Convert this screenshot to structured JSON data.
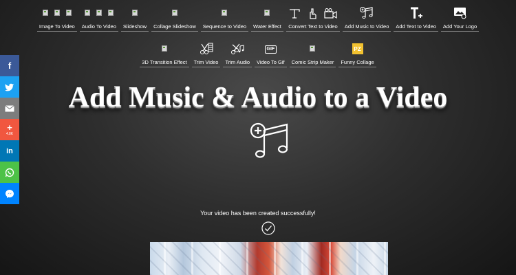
{
  "nav": {
    "row1": [
      {
        "label": "Image To Video",
        "icon": "broken-image-icons"
      },
      {
        "label": "Audio To Video",
        "icon": "broken-image-icons"
      },
      {
        "label": "Slideshow",
        "icon": "broken-image-icon"
      },
      {
        "label": "Collage Slideshow",
        "icon": "broken-image-icon"
      },
      {
        "label": "Sequence to Video",
        "icon": "broken-image-icon"
      },
      {
        "label": "Water Effect",
        "icon": "broken-image-icon"
      },
      {
        "label": "Convert Text to Video",
        "icon": "text-pointer-camera-icons"
      },
      {
        "label": "Add Music to Video",
        "icon": "music-plus-icon"
      },
      {
        "label": "Add Text to Video",
        "icon": "text-plus-icon"
      },
      {
        "label": "Add Your Logo",
        "icon": "image-gear-icon"
      }
    ],
    "row2": [
      {
        "label": "3D Transition Effect",
        "icon": "broken-image-icon"
      },
      {
        "label": "Trim Video",
        "icon": "scissors-film-icon"
      },
      {
        "label": "Trim Audio",
        "icon": "scissors-music-icon"
      },
      {
        "label": "Video To Gif",
        "icon": "gif-icon",
        "badge": "GIF"
      },
      {
        "label": "Comic Strip Maker",
        "icon": "broken-image-icon"
      },
      {
        "label": "Funny Collage",
        "icon": "pz-logo-icon",
        "badge": "PZ"
      }
    ]
  },
  "share": {
    "buttons": [
      {
        "network": "facebook",
        "glyph": "f",
        "color": "#3b5998"
      },
      {
        "network": "twitter",
        "glyph": "t",
        "color": "#1da1f2"
      },
      {
        "network": "email",
        "glyph": "✉",
        "color": "#7d7d7d"
      },
      {
        "network": "share-more",
        "glyph": "+",
        "color": "#f1573f",
        "count": "4.8K"
      },
      {
        "network": "linkedin",
        "glyph": "in",
        "color": "#0077b5"
      },
      {
        "network": "whatsapp",
        "glyph": "✆",
        "color": "#4dc247"
      },
      {
        "network": "messenger",
        "glyph": "⚡",
        "color": "#0084ff"
      }
    ]
  },
  "main": {
    "title": "Add Music & Audio to a Video",
    "status": "Your video has been created successfully!"
  }
}
